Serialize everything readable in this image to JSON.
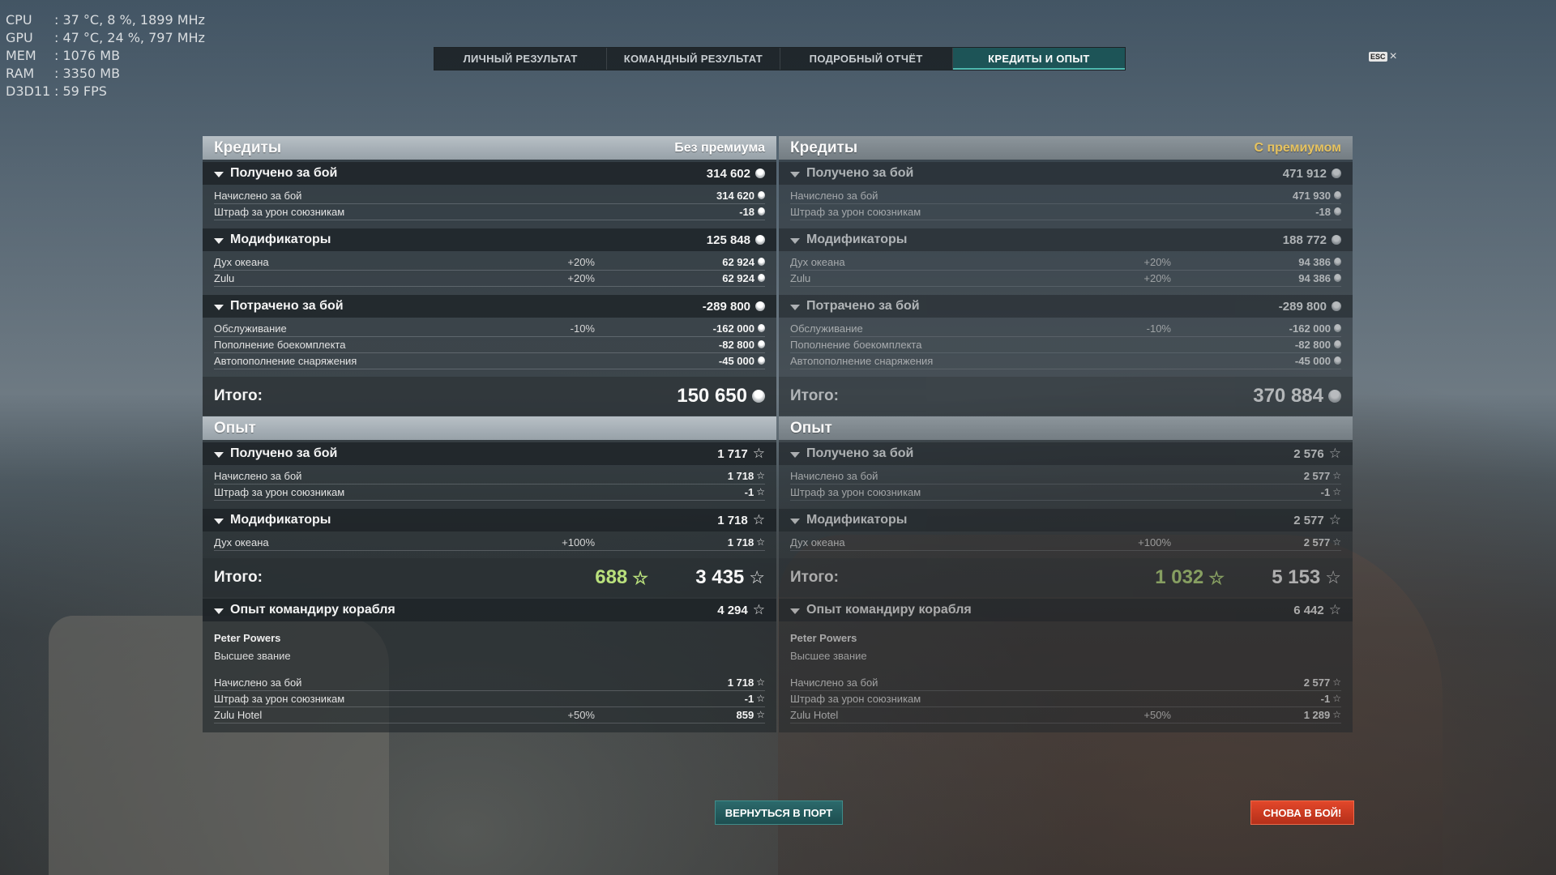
{
  "sysinfo": [
    {
      "k": "CPU",
      "v": ": 37 °C, 8 %, 1899 MHz"
    },
    {
      "k": "GPU",
      "v": ": 47 °C, 24 %, 797 MHz"
    },
    {
      "k": "MEM",
      "v": ": 1076 MB"
    },
    {
      "k": "RAM",
      "v": ": 3350 MB"
    },
    {
      "k": "D3D11",
      "v": ": 59 FPS"
    }
  ],
  "tabs": [
    "ЛИЧНЫЙ РЕЗУЛЬТАТ",
    "КОМАНДНЫЙ РЕЗУЛЬТАТ",
    "ПОДРОБНЫЙ ОТЧЁТ",
    "КРЕДИТЫ И ОПЫТ"
  ],
  "active_tab": "КРЕДИТЫ И ОПЫТ",
  "esc": {
    "key": "ESC",
    "close": "×"
  },
  "left": {
    "credits_title": "Кредиты",
    "premium_label": "Без премиума",
    "earned": {
      "label": "Получено за бой",
      "value": "314 602"
    },
    "earned_rows": [
      {
        "label": "Начислено за бой",
        "value": "314 620"
      },
      {
        "label": "Штраф за урон союзникам",
        "value": "-18"
      }
    ],
    "mods": {
      "label": "Модификаторы",
      "value": "125 848"
    },
    "mods_rows": [
      {
        "label": "Дух океана",
        "pct": "+20%",
        "value": "62 924"
      },
      {
        "label": "Zulu",
        "pct": "+20%",
        "value": "62 924"
      }
    ],
    "spent": {
      "label": "Потрачено за бой",
      "value": "-289 800"
    },
    "spent_rows": [
      {
        "label": "Обслуживание",
        "pct": "-10%",
        "value": "-162 000"
      },
      {
        "label": "Пополнение боекомплекта",
        "pct": "",
        "value": "-82 800"
      },
      {
        "label": "Автопополнение снаряжения",
        "pct": "",
        "value": "-45 000"
      }
    ],
    "credits_total": {
      "label": "Итого:",
      "value": "150 650"
    },
    "xp_title": "Опыт",
    "xp_earned": {
      "label": "Получено за бой",
      "value": "1 717"
    },
    "xp_earned_rows": [
      {
        "label": "Начислено за бой",
        "value": "1 718"
      },
      {
        "label": "Штраф за урон союзникам",
        "value": "-1"
      }
    ],
    "xp_mods": {
      "label": "Модификаторы",
      "value": "1 718"
    },
    "xp_mods_rows": [
      {
        "label": "Дух океана",
        "pct": "+100%",
        "value": "1 718"
      }
    ],
    "xp_total": {
      "label": "Итого:",
      "bonus": "688",
      "value": "3 435"
    },
    "cmd": {
      "label": "Опыт командиру корабля",
      "value": "4 294"
    },
    "cmd_name": "Peter Powers",
    "cmd_rank": "Высшее звание",
    "cmd_rows": [
      {
        "label": "Начислено за бой",
        "pct": "",
        "value": "1 718"
      },
      {
        "label": "Штраф за урон союзникам",
        "pct": "",
        "value": "-1"
      },
      {
        "label": "Zulu Hotel",
        "pct": "+50%",
        "value": "859"
      }
    ]
  },
  "right": {
    "credits_title": "Кредиты",
    "premium_label": "С премиумом",
    "earned": {
      "label": "Получено за бой",
      "value": "471 912"
    },
    "earned_rows": [
      {
        "label": "Начислено за бой",
        "value": "471 930"
      },
      {
        "label": "Штраф за урон союзникам",
        "value": "-18"
      }
    ],
    "mods": {
      "label": "Модификаторы",
      "value": "188 772"
    },
    "mods_rows": [
      {
        "label": "Дух океана",
        "pct": "+20%",
        "value": "94 386"
      },
      {
        "label": "Zulu",
        "pct": "+20%",
        "value": "94 386"
      }
    ],
    "spent": {
      "label": "Потрачено за бой",
      "value": "-289 800"
    },
    "spent_rows": [
      {
        "label": "Обслуживание",
        "pct": "-10%",
        "value": "-162 000"
      },
      {
        "label": "Пополнение боекомплекта",
        "pct": "",
        "value": "-82 800"
      },
      {
        "label": "Автопополнение снаряжения",
        "pct": "",
        "value": "-45 000"
      }
    ],
    "credits_total": {
      "label": "Итого:",
      "value": "370 884"
    },
    "xp_title": "Опыт",
    "xp_earned": {
      "label": "Получено за бой",
      "value": "2 576"
    },
    "xp_earned_rows": [
      {
        "label": "Начислено за бой",
        "value": "2 577"
      },
      {
        "label": "Штраф за урон союзникам",
        "value": "-1"
      }
    ],
    "xp_mods": {
      "label": "Модификаторы",
      "value": "2 577"
    },
    "xp_mods_rows": [
      {
        "label": "Дух океана",
        "pct": "+100%",
        "value": "2 577"
      }
    ],
    "xp_total": {
      "label": "Итого:",
      "bonus": "1 032",
      "value": "5 153"
    },
    "cmd": {
      "label": "Опыт командиру корабля",
      "value": "6 442"
    },
    "cmd_name": "Peter Powers",
    "cmd_rank": "Высшее звание",
    "cmd_rows": [
      {
        "label": "Начислено за бой",
        "pct": "",
        "value": "2 577"
      },
      {
        "label": "Штраф за урон союзникам",
        "pct": "",
        "value": "-1"
      },
      {
        "label": "Zulu Hotel",
        "pct": "+50%",
        "value": "1 289"
      }
    ]
  },
  "buttons": {
    "port": "ВЕРНУТЬСЯ В ПОРТ",
    "battle": "СНОВА В БОЙ!"
  },
  "colors": {
    "accent": "#1d5457",
    "battle": "#d23c22",
    "bonus_xp": "#b9e07c",
    "premium": "#e7c35f"
  }
}
